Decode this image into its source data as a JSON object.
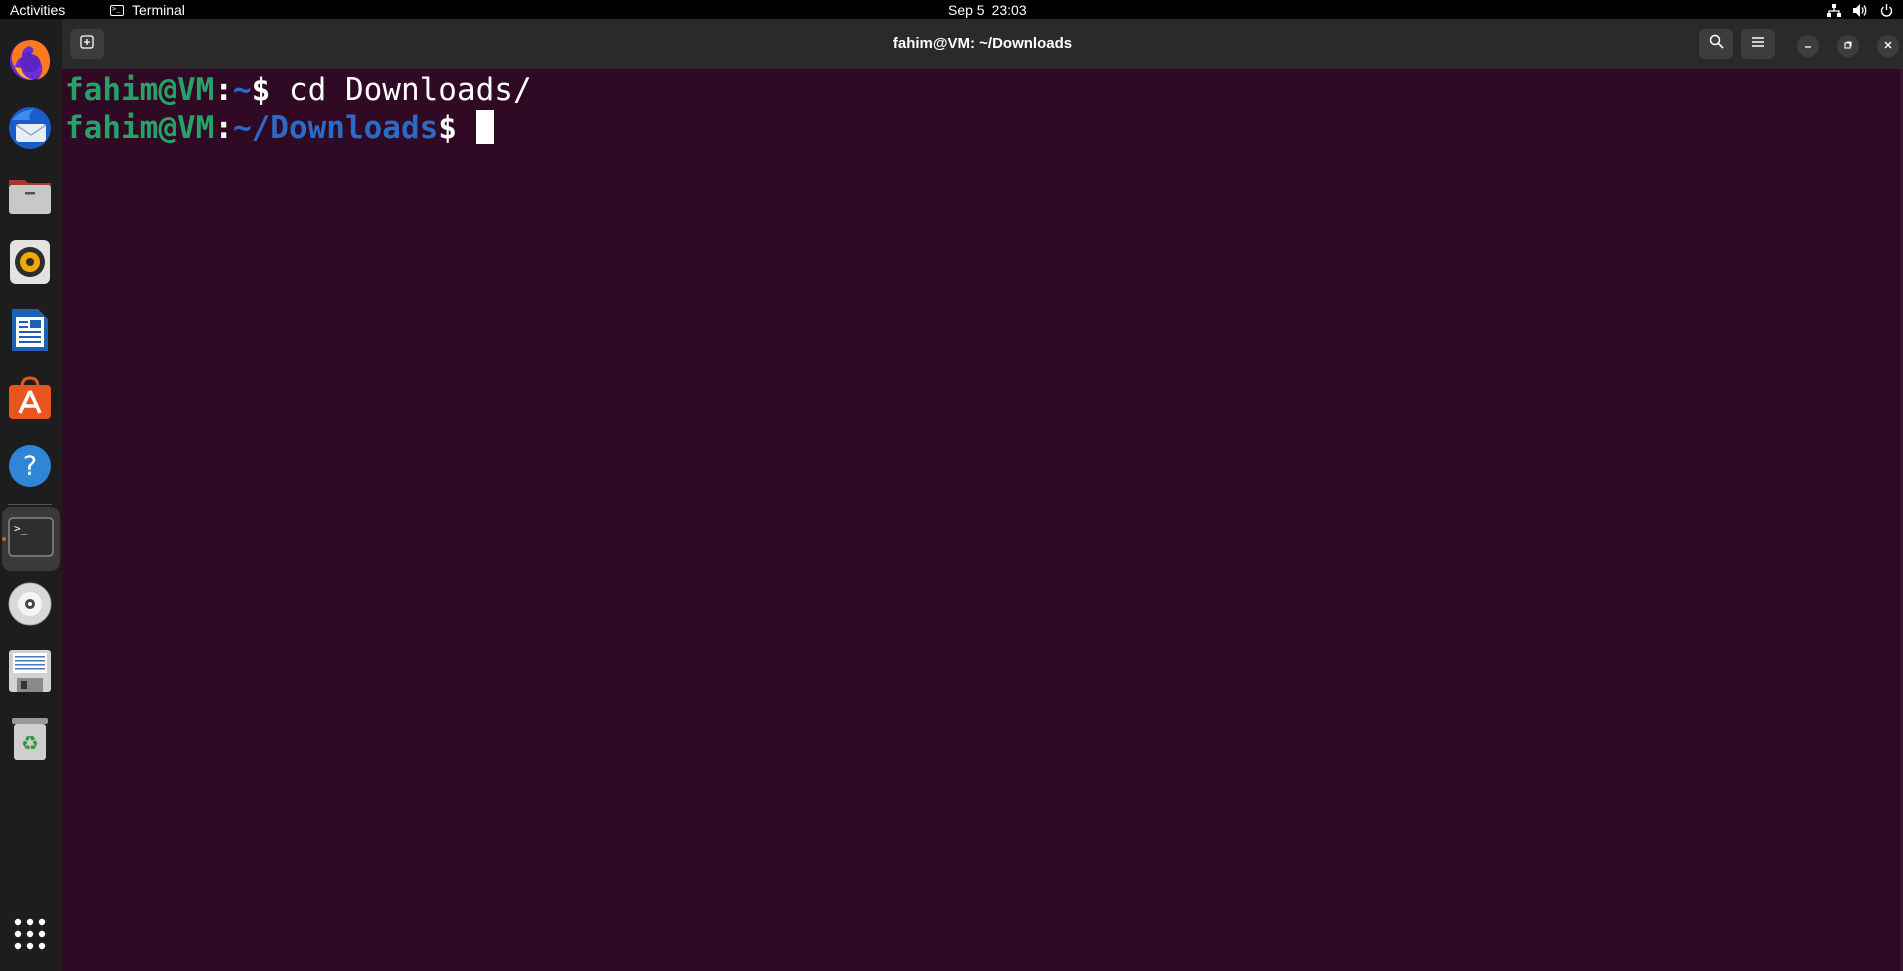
{
  "topbar": {
    "activities_label": "Activities",
    "app_name": "Terminal",
    "date": "Sep 5",
    "time": "23:03",
    "tray_icons": [
      "network-icon",
      "volume-icon",
      "power-icon"
    ]
  },
  "dock": {
    "items": [
      {
        "name": "firefox",
        "icon": "firefox-icon"
      },
      {
        "name": "thunderbird",
        "icon": "thunderbird-mail-icon"
      },
      {
        "name": "files",
        "icon": "files-folder-icon"
      },
      {
        "name": "rhythmbox",
        "icon": "rhythmbox-speaker-icon"
      },
      {
        "name": "libreoffice-writer",
        "icon": "writer-document-icon"
      },
      {
        "name": "ubuntu-software",
        "icon": "software-store-icon"
      },
      {
        "name": "help",
        "icon": "help-question-icon"
      },
      {
        "name": "terminal",
        "icon": "terminal-icon",
        "active": true
      },
      {
        "name": "disc",
        "icon": "optical-disc-icon"
      },
      {
        "name": "disk-drive",
        "icon": "floppy-drive-icon"
      },
      {
        "name": "trash",
        "icon": "recycle-bin-icon"
      }
    ],
    "apps_grid_icon": "show-apps-grid-icon"
  },
  "window": {
    "title": "fahim@VM: ~/Downloads"
  },
  "terminal": {
    "line1": {
      "user_host": "fahim@VM",
      "colon": ":",
      "path": "~",
      "dollar": "$",
      "command": " cd Downloads/"
    },
    "line2": {
      "user_host": "fahim@VM",
      "colon": ":",
      "path": "~/Downloads",
      "dollar": "$",
      "command": " "
    }
  },
  "colors": {
    "terminal_bg": "#300a24",
    "prompt_user": "#26a269",
    "prompt_path": "#2a6bc7",
    "headerbar": "#2a2a2a",
    "dock_bg": "#1d1d1d",
    "accent": "#e95420"
  }
}
